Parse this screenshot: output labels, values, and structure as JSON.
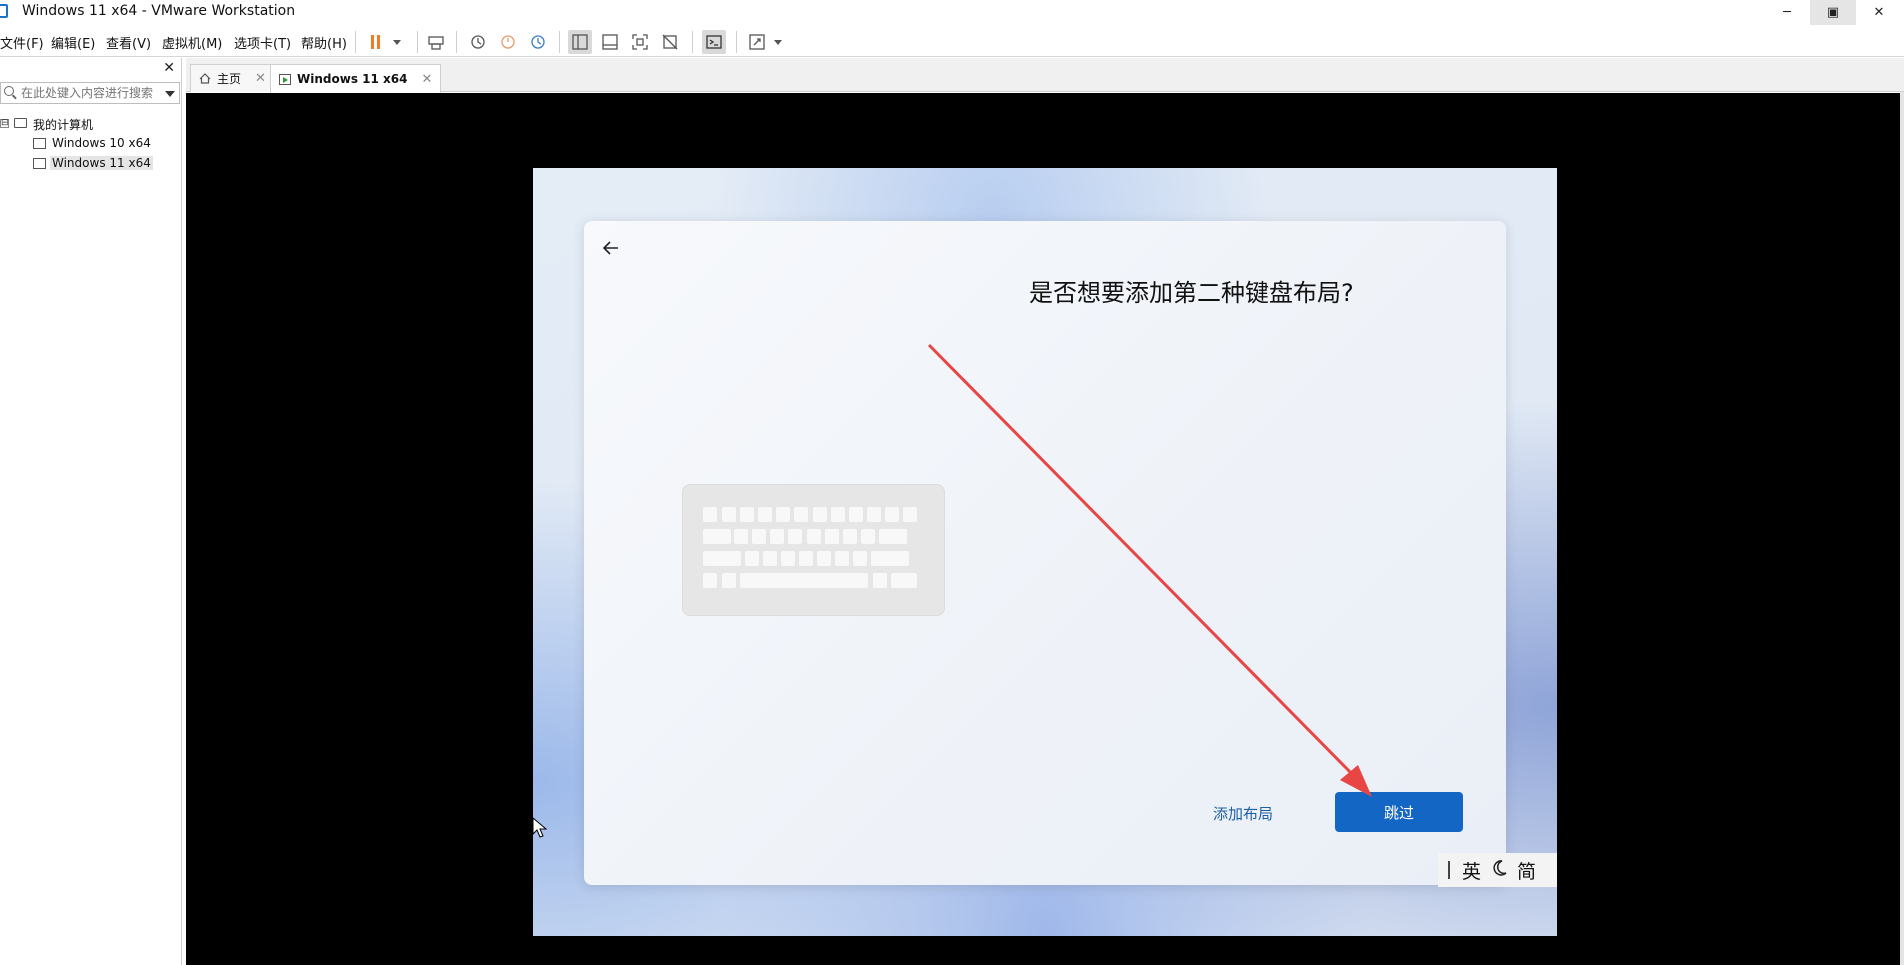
{
  "window": {
    "title": "Windows 11 x64 - VMware Workstation",
    "controls": {
      "minimize": "─",
      "maximize": "▣",
      "close": "✕"
    }
  },
  "menu": {
    "items": [
      "文件(F)",
      "编辑(E)",
      "查看(V)",
      "虚拟机(M)",
      "选项卡(T)",
      "帮助(H)"
    ]
  },
  "library": {
    "close": "✕",
    "search_placeholder": "在此处键入内容进行搜索",
    "root": {
      "expander": "⊟",
      "label": "我的计算机"
    },
    "vms": [
      {
        "label": "Windows 10 x64"
      },
      {
        "label": "Windows 11 x64"
      }
    ]
  },
  "tabs": [
    {
      "label": "主页",
      "close": "✕"
    },
    {
      "label": "Windows 11 x64",
      "close": "✕"
    }
  ],
  "oobe": {
    "title": "是否想要添加第二种键盘布局?",
    "add_layout": "添加布局",
    "skip": "跳过"
  },
  "ime": {
    "lang": "英",
    "mode_icon": "moon-icon",
    "charset": "简"
  },
  "colors": {
    "accent_button": "#1466c4",
    "link": "#1d5fa6",
    "annotation_arrow": "#e84545",
    "pause_icon": "#f47b20"
  }
}
